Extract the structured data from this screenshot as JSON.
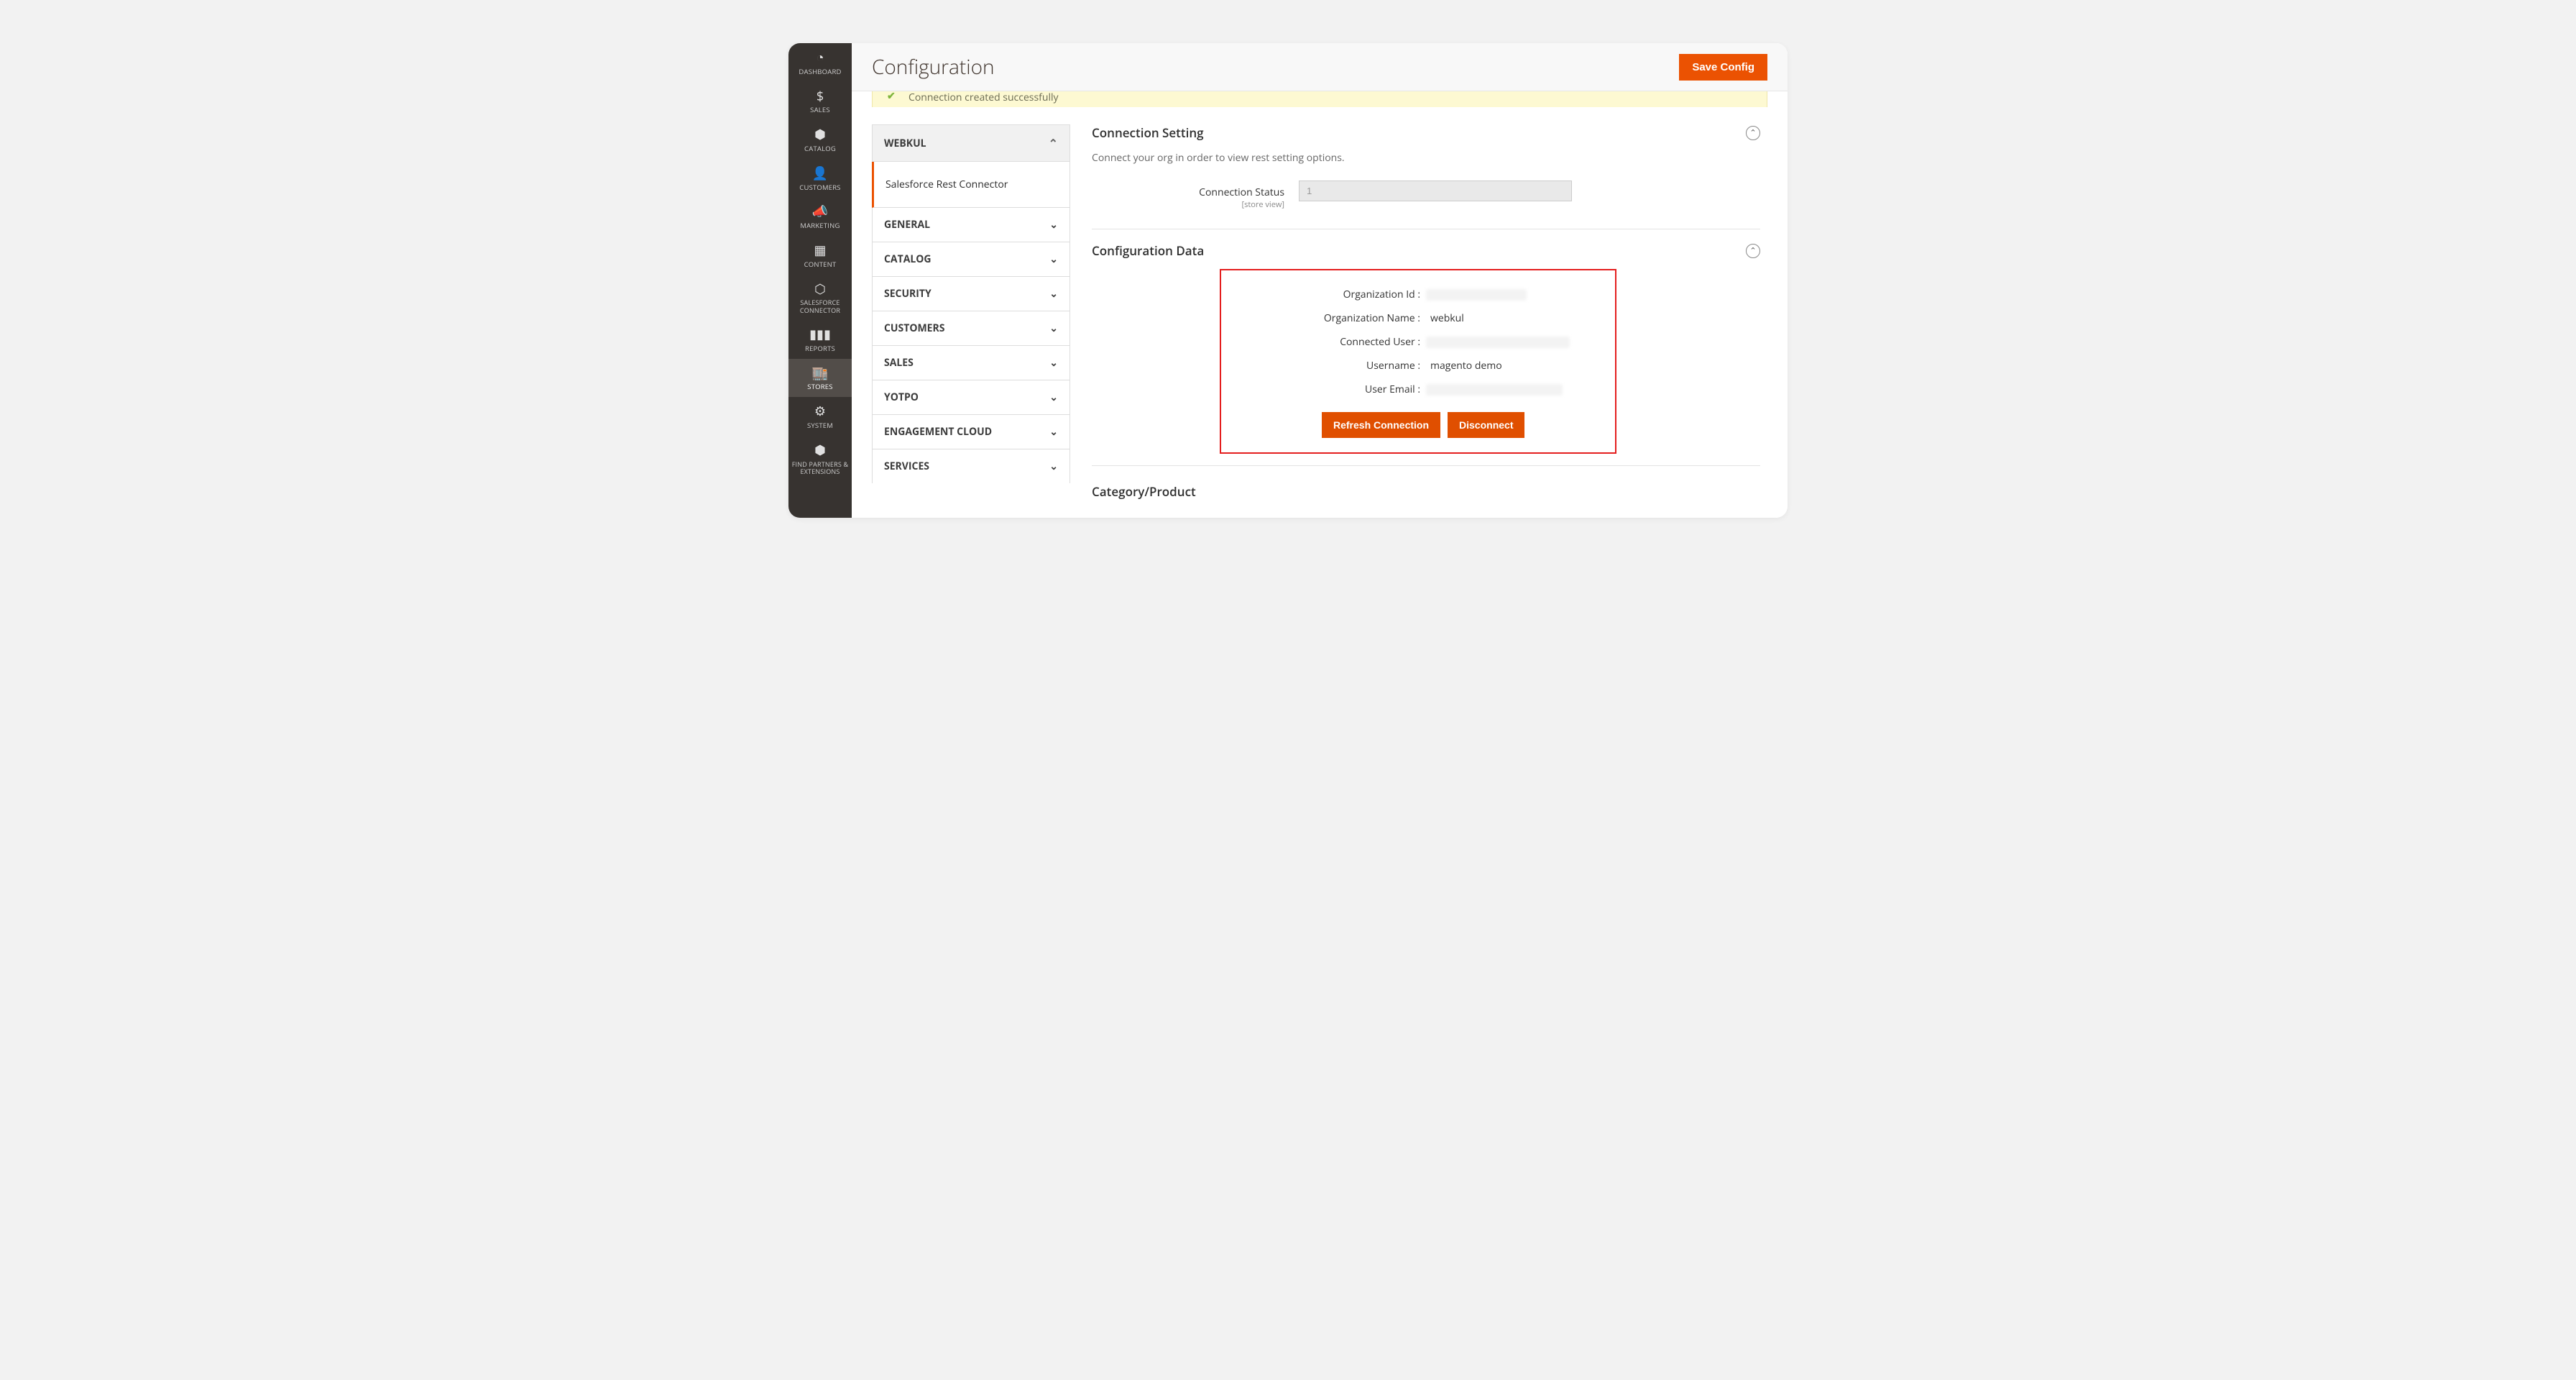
{
  "sidebar": {
    "items": [
      {
        "label": "DASHBOARD"
      },
      {
        "label": "SALES"
      },
      {
        "label": "CATALOG"
      },
      {
        "label": "CUSTOMERS"
      },
      {
        "label": "MARKETING"
      },
      {
        "label": "CONTENT"
      },
      {
        "label": "SALESFORCE CONNECTOR"
      },
      {
        "label": "REPORTS"
      },
      {
        "label": "STORES"
      },
      {
        "label": "SYSTEM"
      },
      {
        "label": "FIND PARTNERS & EXTENSIONS"
      }
    ]
  },
  "header": {
    "title": "Configuration",
    "save_label": "Save Config"
  },
  "alert": {
    "message": "Connection created successfully"
  },
  "config_nav": {
    "expanded_group": "WEBKUL",
    "active_subitem": "Salesforce Rest Connector",
    "collapsed_groups": [
      "GENERAL",
      "CATALOG",
      "SECURITY",
      "CUSTOMERS",
      "SALES",
      "YOTPO",
      "ENGAGEMENT CLOUD",
      "SERVICES"
    ]
  },
  "sections": {
    "connection_setting": {
      "title": "Connection Setting",
      "description": "Connect your org in order to view rest setting options.",
      "status_label": "Connection Status",
      "status_scope": "[store view]",
      "status_value": "1"
    },
    "configuration_data": {
      "title": "Configuration Data",
      "rows": {
        "org_id_label": "Organization Id :",
        "org_name_label": "Organization Name :",
        "org_name_value": "webkul",
        "connected_user_label": "Connected User :",
        "username_label": "Username :",
        "username_value": "magento demo",
        "user_email_label": "User Email :"
      },
      "refresh_label": "Refresh Connection",
      "disconnect_label": "Disconnect"
    },
    "category_product": {
      "title": "Category/Product"
    }
  }
}
